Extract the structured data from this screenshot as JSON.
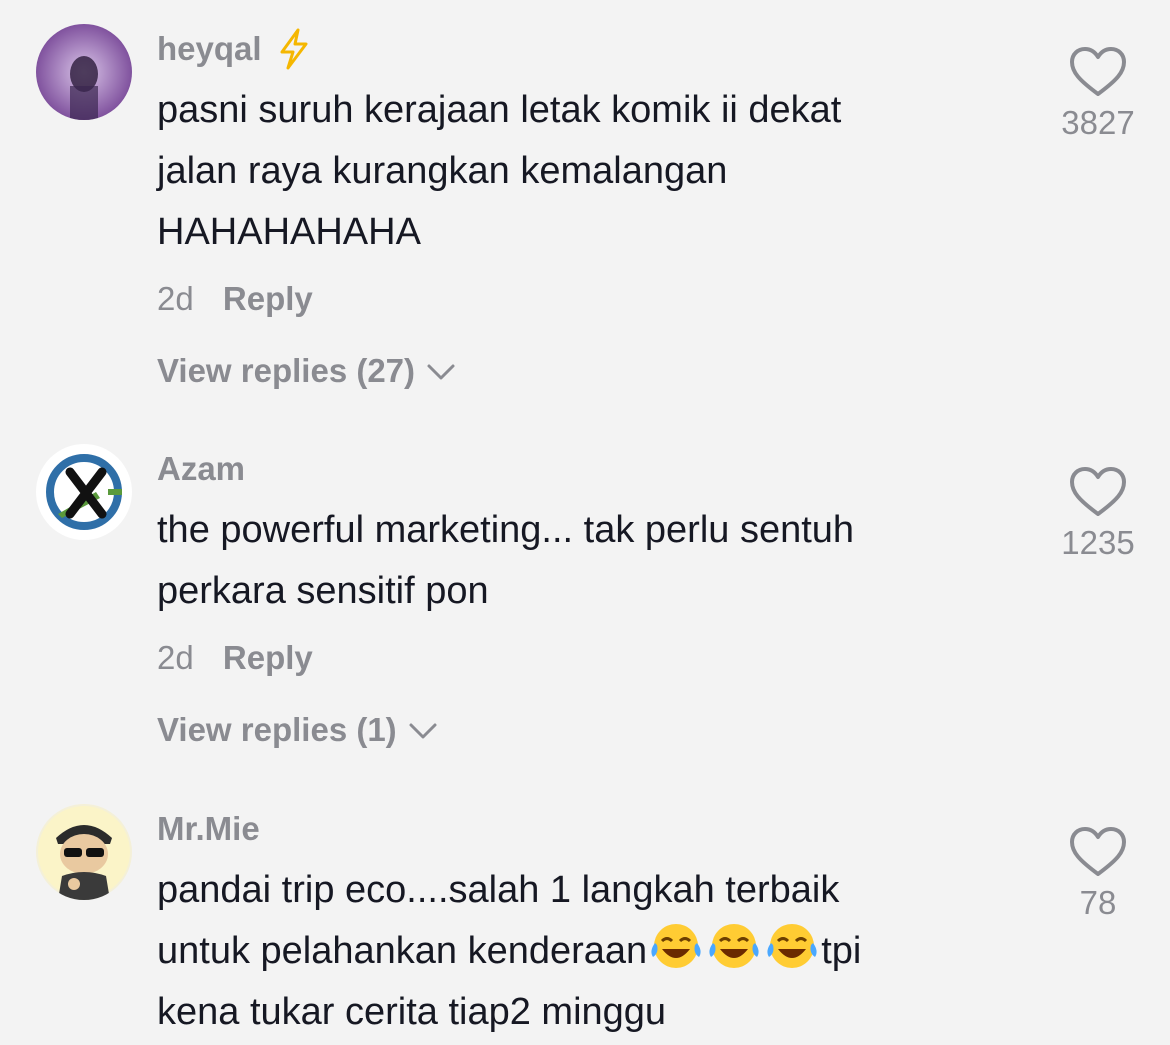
{
  "comments": [
    {
      "username": "heyqal",
      "text": "pasni suruh kerajaan letak komik ii dekat\njalan raya kurangkan kemalangan\nHAHAHAHAHA",
      "time": "2d",
      "reply_label": "Reply",
      "view_replies": "View replies (27)",
      "likes": "3827",
      "badge_icon": "lightning-bolt-icon"
    },
    {
      "username": "Azam",
      "text": "the powerful marketing... tak perlu sentuh\nperkara sensitif pon",
      "time": "2d",
      "reply_label": "Reply",
      "view_replies": "View replies (1)",
      "likes": "1235"
    },
    {
      "username": "Mr.Mie",
      "text_line1": "pandai trip eco....salah 1 langkah terbaik",
      "text_line2_prefix": "untuk pelahankan kenderaan",
      "text_line2_suffix": "tpi",
      "text_line3": "kena tukar cerita tiap2 minggu",
      "emoji_icon": "face-with-tears-of-joy-icon",
      "likes": "78"
    }
  ],
  "colors": {
    "background": "#f3f3f3",
    "primary_text": "#161823",
    "secondary_text": "#8a8b91",
    "bolt": "#f5b700"
  }
}
